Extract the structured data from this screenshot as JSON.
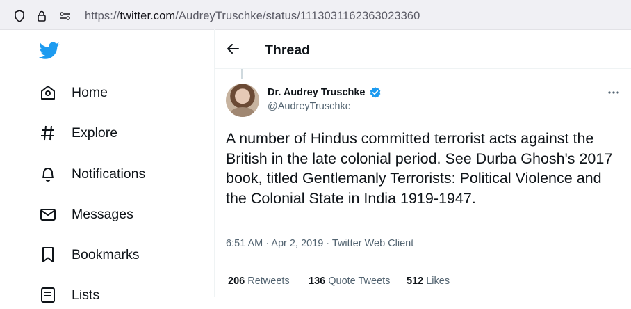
{
  "browser": {
    "url_prefix": "https://",
    "url_host": "twitter.com",
    "url_path": "/AudreyTruschke/status/1113031162363023360"
  },
  "sidebar": {
    "items": [
      {
        "label": "Home",
        "icon": "home-icon"
      },
      {
        "label": "Explore",
        "icon": "hashtag-icon"
      },
      {
        "label": "Notifications",
        "icon": "bell-icon"
      },
      {
        "label": "Messages",
        "icon": "envelope-icon"
      },
      {
        "label": "Bookmarks",
        "icon": "bookmark-icon"
      },
      {
        "label": "Lists",
        "icon": "list-icon"
      }
    ]
  },
  "header": {
    "title": "Thread"
  },
  "tweet": {
    "author_name": "Dr. Audrey Truschke",
    "author_handle": "@AudreyTruschke",
    "text": "A number of Hindus committed terrorist acts against the British in the late colonial period. See Durba Ghosh's 2017 book, titled Gentlemanly Terrorists: Political Violence and the Colonial State in India 1919-1947.",
    "meta": "6:51 AM · Apr 2, 2019 · Twitter Web Client",
    "stats": {
      "retweets_count": "206",
      "retweets_label": "Retweets",
      "quotes_count": "136",
      "quotes_label": "Quote Tweets",
      "likes_count": "512",
      "likes_label": "Likes"
    }
  },
  "colors": {
    "brand": "#1d9bf0",
    "text": "#0f1419",
    "secondary_text": "#536471"
  }
}
